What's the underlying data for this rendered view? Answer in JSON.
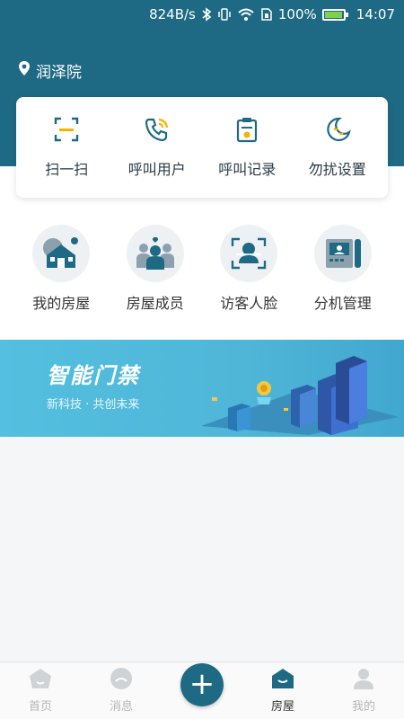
{
  "status_bar": {
    "speed": "824B/s",
    "battery": "100%",
    "time": "14:07"
  },
  "location": {
    "name": "润泽院"
  },
  "quick_actions": [
    {
      "label": "扫一扫",
      "icon": "scan-icon"
    },
    {
      "label": "呼叫用户",
      "icon": "phone-call-icon"
    },
    {
      "label": "呼叫记录",
      "icon": "clipboard-icon"
    },
    {
      "label": "勿扰设置",
      "icon": "moon-icon"
    }
  ],
  "grid_items": [
    {
      "label": "我的房屋",
      "icon": "house-icon"
    },
    {
      "label": "房屋成员",
      "icon": "members-icon"
    },
    {
      "label": "访客人脸",
      "icon": "face-icon"
    },
    {
      "label": "分机管理",
      "icon": "intercom-icon"
    }
  ],
  "banner": {
    "title": "智能门禁",
    "subtitle": "新科技 · 共创未来"
  },
  "tabs": [
    {
      "label": "首页",
      "icon": "home-icon",
      "active": false
    },
    {
      "label": "消息",
      "icon": "message-icon",
      "active": false
    },
    {
      "label": "",
      "icon": "plus-icon",
      "active": false
    },
    {
      "label": "房屋",
      "icon": "house-tab-icon",
      "active": true
    },
    {
      "label": "我的",
      "icon": "profile-icon",
      "active": false
    }
  ],
  "colors": {
    "primary": "#1e6a84",
    "accent": "#f5b400",
    "banner": "#54bfe0"
  }
}
